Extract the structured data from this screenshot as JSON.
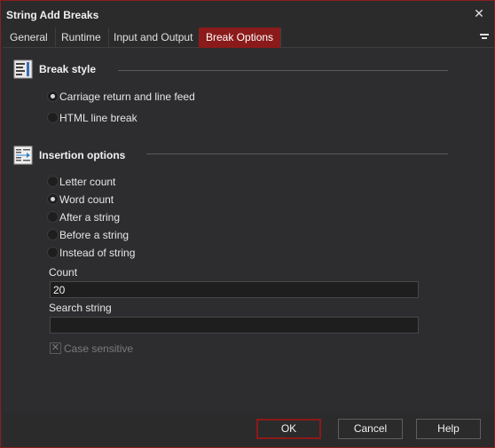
{
  "window": {
    "title": "String Add Breaks"
  },
  "tabs": [
    {
      "label": "General"
    },
    {
      "label": "Runtime"
    },
    {
      "label": "Input and Output"
    },
    {
      "label": "Break Options",
      "active": true
    }
  ],
  "break_style": {
    "title": "Break style",
    "options": [
      {
        "label": "Carriage return and line feed",
        "checked": true
      },
      {
        "label": "HTML line break",
        "checked": false
      }
    ]
  },
  "insertion": {
    "title": "Insertion options",
    "options": [
      {
        "label": "Letter count",
        "checked": false
      },
      {
        "label": "Word count",
        "checked": true
      },
      {
        "label": "After a string",
        "checked": false
      },
      {
        "label": "Before a string",
        "checked": false
      },
      {
        "label": "Instead of string",
        "checked": false
      }
    ],
    "count_label": "Count",
    "count_value": "20",
    "search_label": "Search string",
    "search_value": "",
    "case_sensitive_label": "Case sensitive",
    "case_sensitive_checked": true,
    "case_sensitive_disabled": true
  },
  "buttons": {
    "ok": "OK",
    "cancel": "Cancel",
    "help": "Help"
  },
  "colors": {
    "accent": "#8b1a1a",
    "background": "#2d2d30",
    "text": "#e6e6e6"
  },
  "icons": {
    "close": "close-icon",
    "menu": "menu-icon",
    "break_style": "break-style-icon",
    "insertion": "insertion-options-icon"
  }
}
